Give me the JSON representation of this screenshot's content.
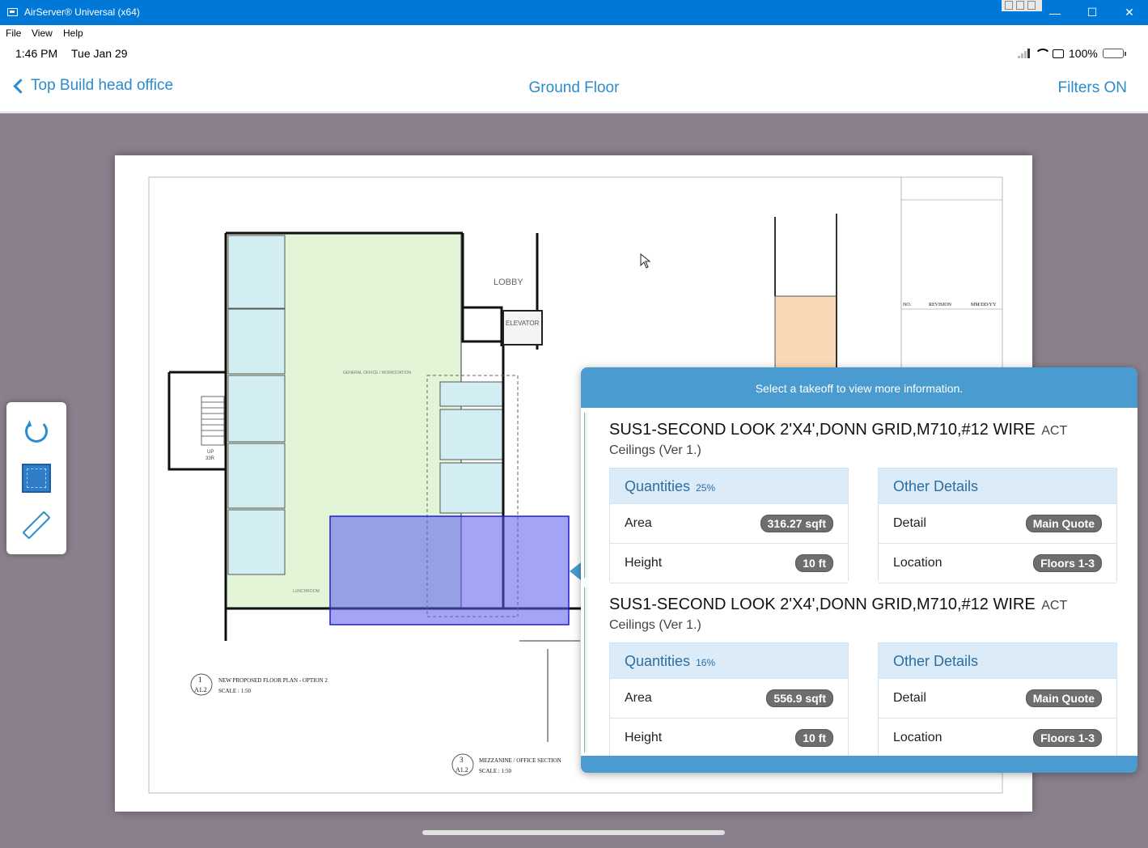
{
  "window": {
    "title": "AirServer® Universal (x64)",
    "minimize": "—",
    "maximize": "☐",
    "close": "✕"
  },
  "menu": {
    "file": "File",
    "view": "View",
    "help": "Help"
  },
  "status": {
    "time": "1:46 PM",
    "date": "Tue Jan 29",
    "battery": "100%"
  },
  "nav": {
    "back_label": "Top Build head office",
    "title": "Ground Floor",
    "filters": "Filters ON"
  },
  "drawing": {
    "lobby": "LOBBY",
    "elevator": "ELEVATOR",
    "up_label": "UP",
    "up_count": "33R",
    "plan_number": "1",
    "plan_sheet": "A1.2",
    "plan_title": "NEW PROPOSED FLOOR PLAN - OPTION 2",
    "plan_scale": "SCALE : 1:50",
    "section_number": "3",
    "section_sheet": "A1.2",
    "section_title": "MEZZANINE / OFFICE SECTION",
    "section_scale": "SCALE : 1:50",
    "revision_col_no": "NO.",
    "revision_col_rev": "REVISION",
    "revision_col_date": "MM/DD/YY",
    "general_label": "GENERAL OFFICE / WORKSTATION",
    "lunchroom": "LUNCHROOM"
  },
  "popover": {
    "hint": "Select a takeoff to view more information.",
    "takeoffs": [
      {
        "name": "SUS1-SECOND LOOK 2'X4',DONN GRID,M710,#12 WIRE",
        "suffix": "ACT",
        "category": "Ceilings (Ver 1.)",
        "quantities_title": "Quantities",
        "quantities_pct": "25%",
        "area_label": "Area",
        "area_value": "316.27 sqft",
        "height_label": "Height",
        "height_value": "10 ft",
        "details_title": "Other Details",
        "detail_label": "Detail",
        "detail_value": "Main Quote",
        "location_label": "Location",
        "location_value": "Floors 1-3"
      },
      {
        "name": "SUS1-SECOND LOOK 2'X4',DONN GRID,M710,#12 WIRE",
        "suffix": "ACT",
        "category": "Ceilings (Ver 1.)",
        "quantities_title": "Quantities",
        "quantities_pct": "16%",
        "area_label": "Area",
        "area_value": "556.9 sqft",
        "height_label": "Height",
        "height_value": "10 ft",
        "details_title": "Other Details",
        "detail_label": "Detail",
        "detail_value": "Main Quote",
        "location_label": "Location",
        "location_value": "Floors 1-3"
      }
    ]
  },
  "colors": {
    "accent": "#2a8ccc",
    "titlebar": "#0078d7",
    "popover": "#4a9bd0",
    "takeoff_selection": "#5a5af0"
  },
  "tools": [
    "refresh-icon",
    "area-takeoff-icon",
    "ruler-icon"
  ]
}
